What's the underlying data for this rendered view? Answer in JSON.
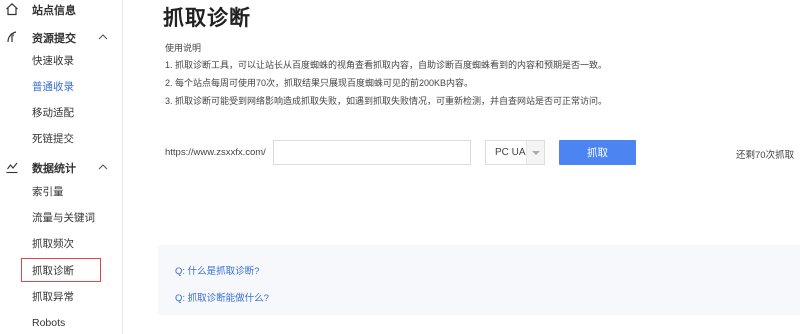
{
  "sidebar": {
    "groups": [
      {
        "label": "站点信息",
        "icon": "home-icon"
      },
      {
        "label": "资源提交",
        "icon": "submit-icon"
      },
      {
        "label": "数据统计",
        "icon": "stats-icon"
      }
    ],
    "resource_items": [
      "快速收录",
      "普通收录",
      "移动适配",
      "死链提交"
    ],
    "stats_items": [
      "索引量",
      "流量与关键词",
      "抓取频次",
      "抓取诊断",
      "抓取异常",
      "Robots"
    ]
  },
  "main": {
    "title": "抓取诊断",
    "instructions_heading": "使用说明",
    "instructions": [
      "1. 抓取诊断工具，可以让站长从百度蜘蛛的视角查看抓取内容，自助诊断百度蜘蛛看到的内容和预期是否一致。",
      "2. 每个站点每周可使用70次，抓取结果只展现百度蜘蛛可见的前200KB内容。",
      "3. 抓取诊断可能受到网络影响造成抓取失败，如遇到抓取失败情况，可重新检测，并自查网站是否可正常访问。"
    ],
    "site_url": "https://www.zsxxfx.com/",
    "url_input_value": "",
    "ua_selected": "PC UA",
    "fetch_button": "抓取",
    "remaining_text": "还剩70次抓取",
    "faq": [
      "Q: 什么是抓取诊断?",
      "Q: 抓取诊断能做什么?"
    ]
  }
}
